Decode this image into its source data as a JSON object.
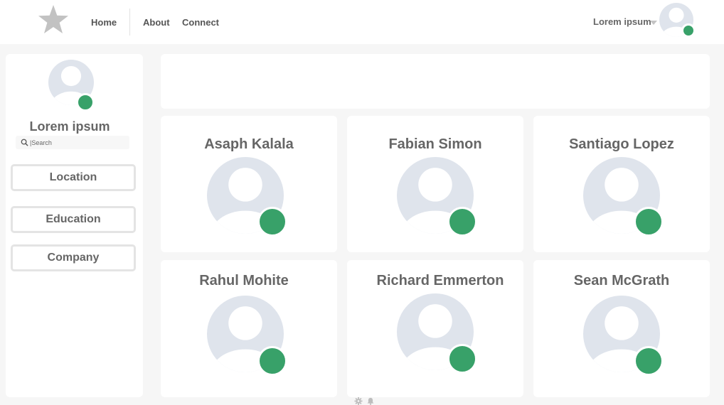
{
  "header": {
    "logo_icon": "star-icon",
    "nav": [
      {
        "label": "Home"
      },
      {
        "label": "About"
      },
      {
        "label": "Connect"
      }
    ],
    "user_name": "Lorem ipsum",
    "user_menu_icon": "caret-down-icon",
    "user_status": "online"
  },
  "sidebar": {
    "title": "Lorem ipsum",
    "search": {
      "placeholder": "|Search",
      "icon": "search-icon"
    },
    "filters": [
      {
        "label": "Location"
      },
      {
        "label": "Education"
      },
      {
        "label": "Company"
      }
    ]
  },
  "people": [
    {
      "name": "Asaph Kalala",
      "status": "online"
    },
    {
      "name": "Fabian Simon",
      "status": "online"
    },
    {
      "name": "Santiago Lopez",
      "status": "online"
    },
    {
      "name": "Rahul Mohite",
      "status": "online"
    },
    {
      "name": "Richard Emmerton",
      "status": "online"
    },
    {
      "name": "Sean McGrath",
      "status": "online"
    }
  ],
  "footer_icons": [
    "gear-icon",
    "bell-icon"
  ],
  "colors": {
    "status_online": "#38a169",
    "avatar_bg": "#dfe4ec",
    "page_bg": "#f6f6f6"
  }
}
